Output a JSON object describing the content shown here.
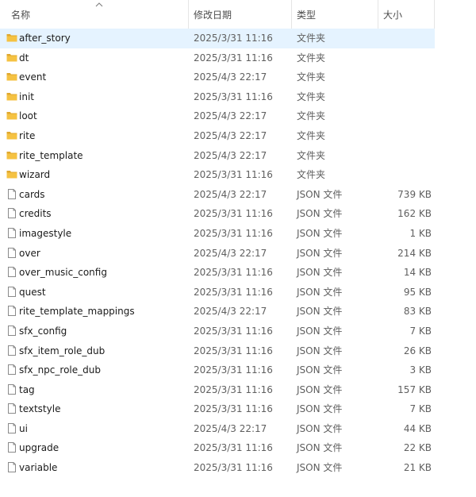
{
  "header": {
    "name_label": "名称",
    "date_label": "修改日期",
    "type_label": "类型",
    "size_label": "大小"
  },
  "files": [
    {
      "name": "after_story",
      "date": "2025/3/31 11:16",
      "type": "文件夹",
      "size": "",
      "kind": "folder",
      "selected": true
    },
    {
      "name": "dt",
      "date": "2025/3/31 11:16",
      "type": "文件夹",
      "size": "",
      "kind": "folder"
    },
    {
      "name": "event",
      "date": "2025/4/3 22:17",
      "type": "文件夹",
      "size": "",
      "kind": "folder"
    },
    {
      "name": "init",
      "date": "2025/3/31 11:16",
      "type": "文件夹",
      "size": "",
      "kind": "folder"
    },
    {
      "name": "loot",
      "date": "2025/4/3 22:17",
      "type": "文件夹",
      "size": "",
      "kind": "folder"
    },
    {
      "name": "rite",
      "date": "2025/4/3 22:17",
      "type": "文件夹",
      "size": "",
      "kind": "folder"
    },
    {
      "name": "rite_template",
      "date": "2025/4/3 22:17",
      "type": "文件夹",
      "size": "",
      "kind": "folder"
    },
    {
      "name": "wizard",
      "date": "2025/3/31 11:16",
      "type": "文件夹",
      "size": "",
      "kind": "folder"
    },
    {
      "name": "cards",
      "date": "2025/4/3 22:17",
      "type": "JSON 文件",
      "size": "739 KB",
      "kind": "file"
    },
    {
      "name": "credits",
      "date": "2025/3/31 11:16",
      "type": "JSON 文件",
      "size": "162 KB",
      "kind": "file"
    },
    {
      "name": "imagestyle",
      "date": "2025/3/31 11:16",
      "type": "JSON 文件",
      "size": "1 KB",
      "kind": "file"
    },
    {
      "name": "over",
      "date": "2025/4/3 22:17",
      "type": "JSON 文件",
      "size": "214 KB",
      "kind": "file"
    },
    {
      "name": "over_music_config",
      "date": "2025/3/31 11:16",
      "type": "JSON 文件",
      "size": "14 KB",
      "kind": "file"
    },
    {
      "name": "quest",
      "date": "2025/3/31 11:16",
      "type": "JSON 文件",
      "size": "95 KB",
      "kind": "file"
    },
    {
      "name": "rite_template_mappings",
      "date": "2025/4/3 22:17",
      "type": "JSON 文件",
      "size": "83 KB",
      "kind": "file"
    },
    {
      "name": "sfx_config",
      "date": "2025/3/31 11:16",
      "type": "JSON 文件",
      "size": "7 KB",
      "kind": "file"
    },
    {
      "name": "sfx_item_role_dub",
      "date": "2025/3/31 11:16",
      "type": "JSON 文件",
      "size": "26 KB",
      "kind": "file"
    },
    {
      "name": "sfx_npc_role_dub",
      "date": "2025/3/31 11:16",
      "type": "JSON 文件",
      "size": "3 KB",
      "kind": "file"
    },
    {
      "name": "tag",
      "date": "2025/3/31 11:16",
      "type": "JSON 文件",
      "size": "157 KB",
      "kind": "file"
    },
    {
      "name": "textstyle",
      "date": "2025/3/31 11:16",
      "type": "JSON 文件",
      "size": "7 KB",
      "kind": "file"
    },
    {
      "name": "ui",
      "date": "2025/4/3 22:17",
      "type": "JSON 文件",
      "size": "44 KB",
      "kind": "file"
    },
    {
      "name": "upgrade",
      "date": "2025/3/31 11:16",
      "type": "JSON 文件",
      "size": "22 KB",
      "kind": "file"
    },
    {
      "name": "variable",
      "date": "2025/3/31 11:16",
      "type": "JSON 文件",
      "size": "21 KB",
      "kind": "file"
    }
  ],
  "colors": {
    "selected_row": "#e5f3ff",
    "folder": "#f5c242",
    "folder_dark": "#e0a82e"
  },
  "icons": {
    "folder": "folder-icon",
    "file": "json-file-icon",
    "sort": "sort-ascending-icon"
  }
}
